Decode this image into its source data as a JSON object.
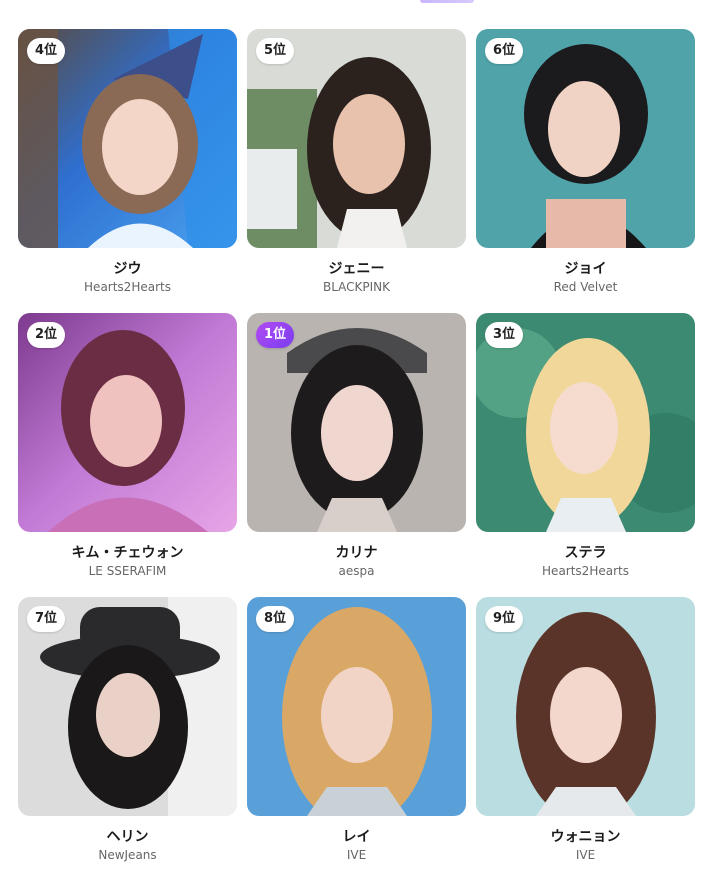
{
  "ranking": {
    "cards": [
      {
        "rank_label": "4位",
        "name": "ジウ",
        "group": "Hearts2Hearts"
      },
      {
        "rank_label": "5位",
        "name": "ジェニー",
        "group": "BLACKPINK"
      },
      {
        "rank_label": "6位",
        "name": "ジョイ",
        "group": "Red Velvet"
      },
      {
        "rank_label": "2位",
        "name": "キム・チェウォン",
        "group": "LE SSERAFIM"
      },
      {
        "rank_label": "1位",
        "name": "カリナ",
        "group": "aespa"
      },
      {
        "rank_label": "3位",
        "name": "ステラ",
        "group": "Hearts2Hearts"
      },
      {
        "rank_label": "7位",
        "name": "ヘリン",
        "group": "NewJeans"
      },
      {
        "rank_label": "8位",
        "name": "レイ",
        "group": "IVE"
      },
      {
        "rank_label": "9位",
        "name": "ウォニョン",
        "group": "IVE"
      }
    ]
  },
  "colors": {
    "first_place_badge": "#9b45f2",
    "badge_background": "#ffffff",
    "name_text": "#1a1a1a",
    "group_text": "#666666"
  }
}
